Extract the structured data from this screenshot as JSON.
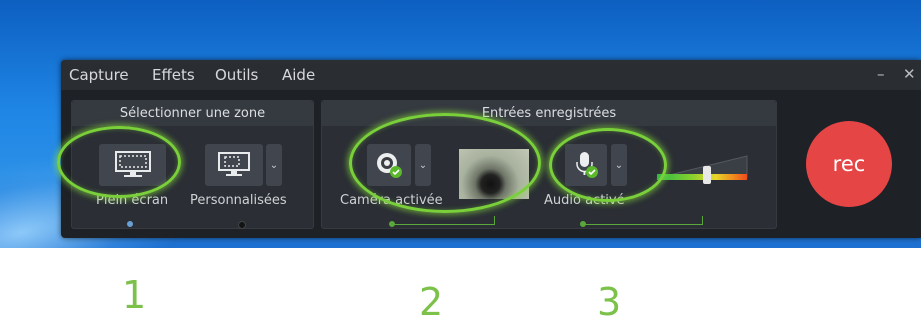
{
  "menu": {
    "items": [
      "Capture",
      "Effets",
      "Outils",
      "Aide"
    ],
    "minimize": "–",
    "close": "✕"
  },
  "zone_panel": {
    "title": "Sélectionner une zone",
    "full_screen": "Plein écran",
    "custom": "Personnalisées"
  },
  "inputs_panel": {
    "title": "Entrées enregistrées",
    "camera": "Caméra activée",
    "audio": "Audio activé",
    "audio_level_percent": 55
  },
  "rec_label": "rec",
  "annotations": [
    "1",
    "2",
    "3"
  ],
  "colors": {
    "highlight": "#7ad03a",
    "rec": "#e64545",
    "panel": "#2b2f35"
  }
}
